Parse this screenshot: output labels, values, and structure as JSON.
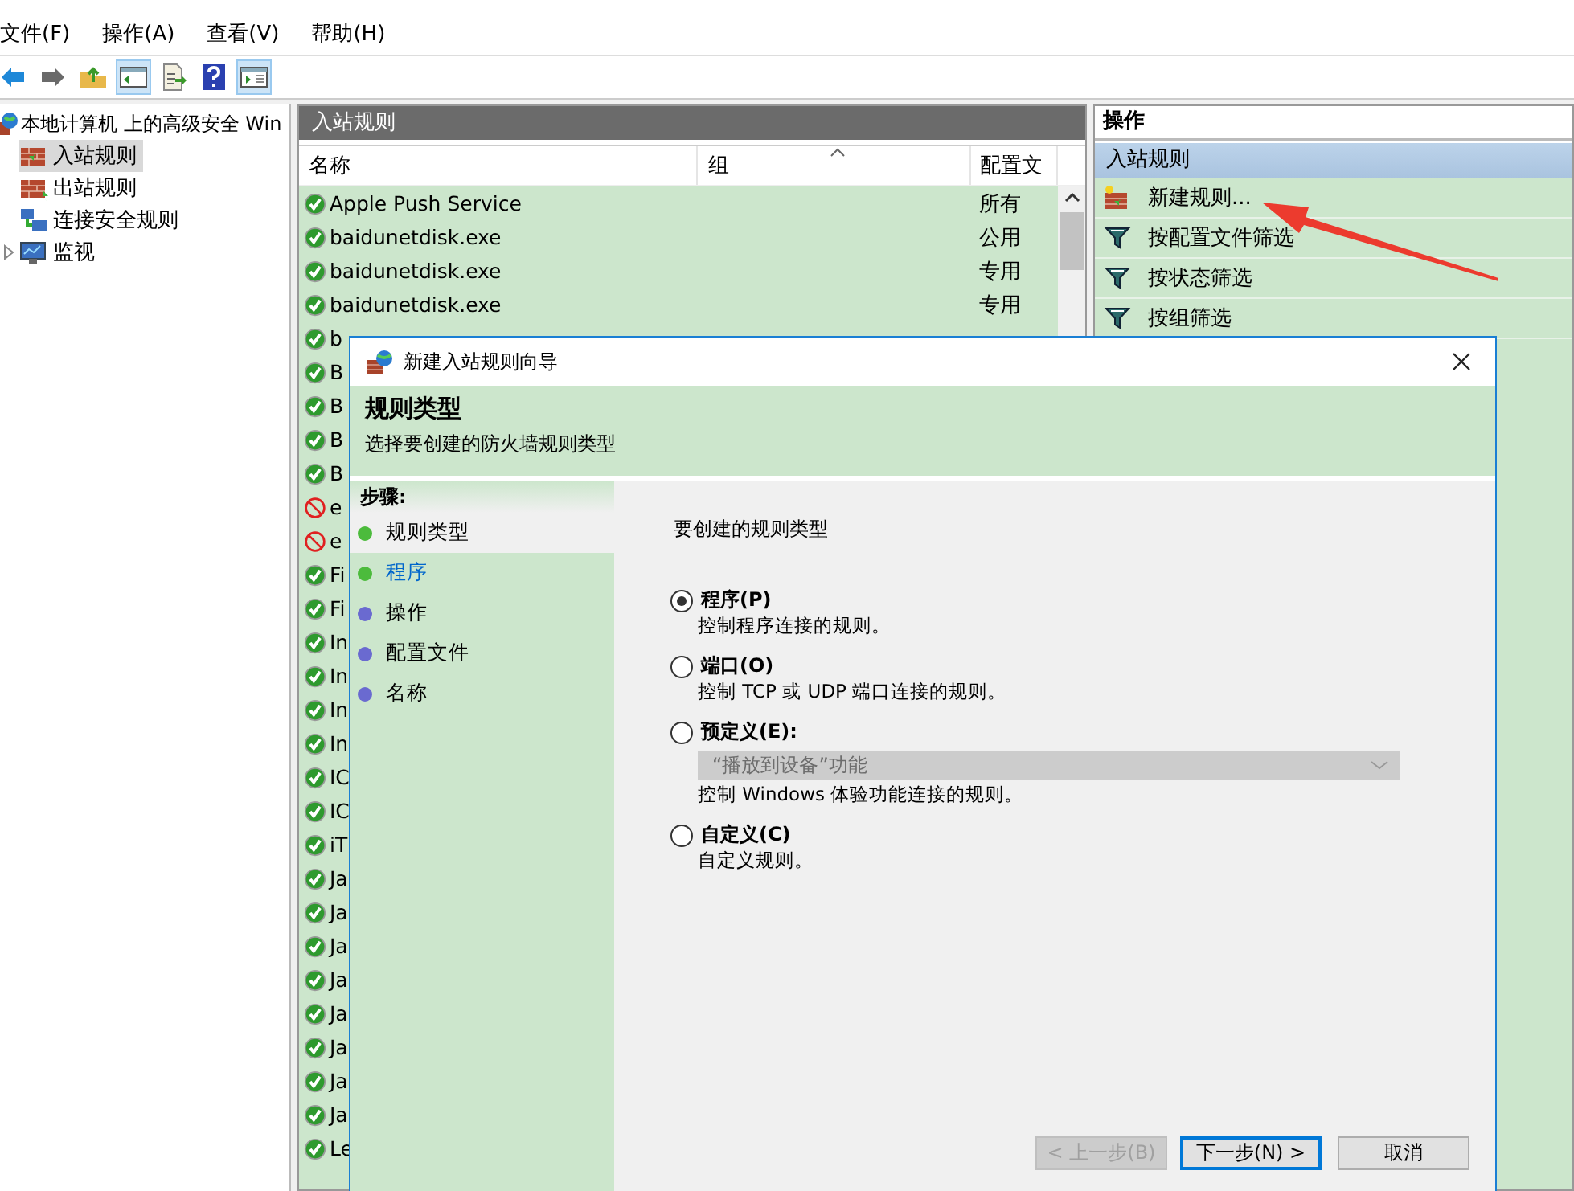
{
  "menu": [
    "文件(F)",
    "操作(A)",
    "查看(V)",
    "帮助(H)"
  ],
  "toolbar": [
    {
      "kind": "back",
      "pressed": false
    },
    {
      "kind": "forward",
      "pressed": false
    },
    {
      "kind": "up",
      "pressed": false
    },
    {
      "kind": "tree",
      "pressed": true
    },
    {
      "kind": "export",
      "pressed": false
    },
    {
      "kind": "help",
      "pressed": false
    },
    {
      "kind": "pane",
      "pressed": true
    }
  ],
  "tree": {
    "label": "本地计算机 上的高级安全 Win",
    "children": [
      {
        "kind": "inbound",
        "label": "入站规则",
        "selected": true
      },
      {
        "kind": "outbound",
        "label": "出站规则",
        "selected": false
      },
      {
        "kind": "security",
        "label": "连接安全规则",
        "selected": false
      },
      {
        "kind": "monitor",
        "label": "监视",
        "selected": false,
        "expanded": false
      }
    ]
  },
  "rules": {
    "title": "入站规则",
    "columns": [
      "名称",
      "组",
      "配置文"
    ],
    "rows": [
      {
        "kind": "allowed",
        "name": "Apple Push Service",
        "profile": "所有"
      },
      {
        "kind": "allowed",
        "name": "baidunetdisk.exe",
        "profile": "公用"
      },
      {
        "kind": "allowed",
        "name": "baidunetdisk.exe",
        "profile": "专用"
      },
      {
        "kind": "allowed",
        "name": "baidunetdisk.exe",
        "profile": "专用"
      },
      {
        "kind": "allowed",
        "name": "b"
      },
      {
        "kind": "allowed",
        "name": "B"
      },
      {
        "kind": "allowed",
        "name": "B"
      },
      {
        "kind": "allowed",
        "name": "B"
      },
      {
        "kind": "allowed",
        "name": "B"
      },
      {
        "kind": "blocked",
        "name": "e"
      },
      {
        "kind": "blocked",
        "name": "e"
      },
      {
        "kind": "allowed",
        "name": "Fi"
      },
      {
        "kind": "allowed",
        "name": "Fi"
      },
      {
        "kind": "allowed",
        "name": "In"
      },
      {
        "kind": "allowed",
        "name": "In"
      },
      {
        "kind": "allowed",
        "name": "In"
      },
      {
        "kind": "allowed",
        "name": "In"
      },
      {
        "kind": "allowed",
        "name": "IC"
      },
      {
        "kind": "allowed",
        "name": "IC"
      },
      {
        "kind": "allowed",
        "name": "iT"
      },
      {
        "kind": "allowed",
        "name": "Ja"
      },
      {
        "kind": "allowed",
        "name": "Ja"
      },
      {
        "kind": "allowed",
        "name": "Ja"
      },
      {
        "kind": "allowed",
        "name": "Ja"
      },
      {
        "kind": "allowed",
        "name": "Ja"
      },
      {
        "kind": "allowed",
        "name": "Ja"
      },
      {
        "kind": "allowed",
        "name": "Ja"
      },
      {
        "kind": "allowed",
        "name": "Ja"
      },
      {
        "kind": "allowed",
        "name": "Le"
      }
    ]
  },
  "actions": {
    "title": "操作",
    "section": "入站规则",
    "items": [
      {
        "kind": "new",
        "label": "新建规则..."
      },
      {
        "kind": "filter",
        "label": "按配置文件筛选"
      },
      {
        "kind": "filter",
        "label": "按状态筛选"
      },
      {
        "kind": "filter",
        "label": "按组筛选"
      }
    ]
  },
  "dialog": {
    "title": "新建入站规则向导",
    "heading": "规则类型",
    "subheading": "选择要创建的防火墙规则类型",
    "steps_title": "步骤:",
    "steps": [
      {
        "label": "规则类型",
        "selected": true,
        "link": false,
        "color": "#4cbb3c"
      },
      {
        "label": "程序",
        "selected": false,
        "link": true,
        "color": "#4cbb3c"
      },
      {
        "label": "操作",
        "selected": false,
        "link": false,
        "color": "#6a6ad0"
      },
      {
        "label": "配置文件",
        "selected": false,
        "link": false,
        "color": "#6a6ad0"
      },
      {
        "label": "名称",
        "selected": false,
        "link": false,
        "color": "#6a6ad0"
      }
    ],
    "prompt": "要创建的规则类型",
    "options": [
      {
        "label": "程序(P)",
        "selected": true,
        "description": "控制程序连接的规则。"
      },
      {
        "label": "端口(O)",
        "selected": false,
        "description": "控制 TCP 或 UDP 端口连接的规则。"
      },
      {
        "label": "预定义(E):",
        "selected": false,
        "dropdown": {
          "value": "“播放到设备”功能",
          "disabled": true
        },
        "description": "控制 Windows 体验功能连接的规则。"
      },
      {
        "label": "自定义(C)",
        "selected": false,
        "description": "自定义规则。"
      }
    ],
    "buttons": [
      {
        "label": "< 上一步(B)",
        "disabled": true,
        "default": false
      },
      {
        "label": "下一步(N) >",
        "disabled": false,
        "default": true
      },
      {
        "label": "取消",
        "disabled": false,
        "default": false
      }
    ]
  }
}
